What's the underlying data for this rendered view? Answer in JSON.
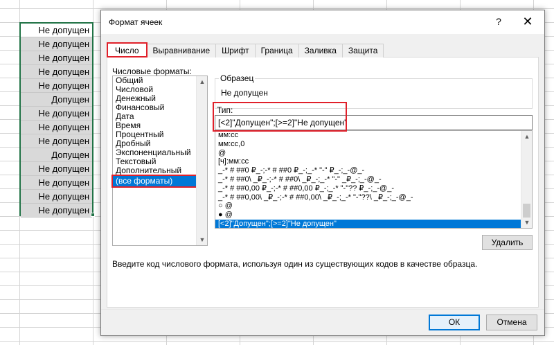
{
  "sheet": {
    "cells": [
      {
        "text": "Не допущен",
        "selected": false
      },
      {
        "text": "Не допущен",
        "selected": true
      },
      {
        "text": "Не допущен",
        "selected": true
      },
      {
        "text": "Не допущен",
        "selected": true
      },
      {
        "text": "Не допущен",
        "selected": true
      },
      {
        "text": "Допущен",
        "selected": true
      },
      {
        "text": "Не допущен",
        "selected": true
      },
      {
        "text": "Не допущен",
        "selected": true
      },
      {
        "text": "Не допущен",
        "selected": true
      },
      {
        "text": "Допущен",
        "selected": true
      },
      {
        "text": "Не допущен",
        "selected": true
      },
      {
        "text": "Не допущен",
        "selected": true
      },
      {
        "text": "Не допущен",
        "selected": true
      },
      {
        "text": "Не допущен",
        "selected": true
      }
    ]
  },
  "dialog": {
    "title": "Формат ячеек",
    "help_glyph": "?",
    "close_glyph": "✕",
    "tabs": [
      {
        "label": "Число",
        "active": true
      },
      {
        "label": "Выравнивание",
        "active": false
      },
      {
        "label": "Шрифт",
        "active": false
      },
      {
        "label": "Граница",
        "active": false
      },
      {
        "label": "Заливка",
        "active": false
      },
      {
        "label": "Защита",
        "active": false
      }
    ],
    "categories_label": "Числовые форматы:",
    "categories": [
      {
        "label": "Общий",
        "selected": false
      },
      {
        "label": "Числовой",
        "selected": false
      },
      {
        "label": "Денежный",
        "selected": false
      },
      {
        "label": "Финансовый",
        "selected": false
      },
      {
        "label": "Дата",
        "selected": false
      },
      {
        "label": "Время",
        "selected": false
      },
      {
        "label": "Процентный",
        "selected": false
      },
      {
        "label": "Дробный",
        "selected": false
      },
      {
        "label": "Экспоненциальный",
        "selected": false
      },
      {
        "label": "Текстовый",
        "selected": false
      },
      {
        "label": "Дополнительный",
        "selected": false
      },
      {
        "label": "(все форматы)",
        "selected": true
      }
    ],
    "sample_label": "Образец",
    "sample_value": "Не допущен",
    "type_label": "Тип:",
    "type_value": "[<2]\"Допущен\";[>=2]\"Не допущен\"",
    "formats": [
      {
        "label": "мм:сс",
        "selected": false
      },
      {
        "label": "мм:сс,0",
        "selected": false
      },
      {
        "label": "@",
        "selected": false
      },
      {
        "label": "[ч]:мм:сс",
        "selected": false
      },
      {
        "label": "_-* # ##0 ₽_-;-* # ##0 ₽_-;_-* \"-\" ₽_-;_-@_-",
        "selected": false
      },
      {
        "label": "_-* # ##0\\ _₽_-;-* # ##0\\ _₽_-;_-* \"-\" _₽_-;_-@_-",
        "selected": false
      },
      {
        "label": "_-* # ##0,00 ₽_-;-* # ##0,00 ₽_-;_-* \"-\"?? ₽_-;_-@_-",
        "selected": false
      },
      {
        "label": "_-* # ##0,00\\ _₽_-;-* # ##0,00\\ _₽_-;_-* \"-\"??\\ _₽_-;_-@_-",
        "selected": false
      },
      {
        "label": "○ @",
        "selected": false
      },
      {
        "label": "● @",
        "selected": false
      },
      {
        "label": "[<2]\"Допущен\";[>=2]\"Не допущен\"",
        "selected": true
      }
    ],
    "delete_label": "Удалить",
    "hint": "Введите код числового формата, используя один из существующих кодов в качестве образца.",
    "ok_label": "ОК",
    "cancel_label": "Отмена"
  },
  "colors": {
    "highlight_red": "#e0202a",
    "selection_blue": "#0078d7",
    "excel_green": "#217346"
  }
}
